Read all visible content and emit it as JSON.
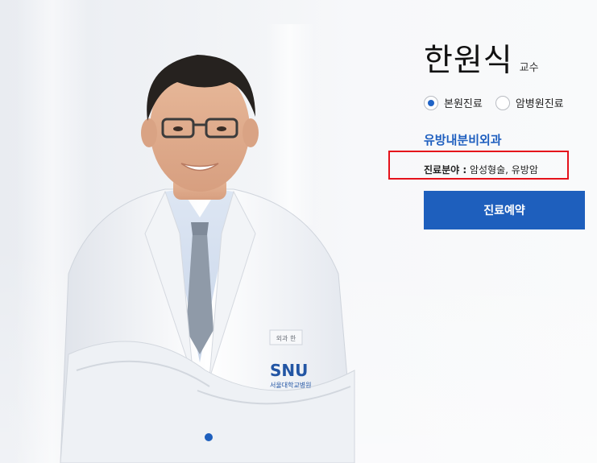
{
  "doctor": {
    "name": "한원식",
    "title": "교수",
    "department": "유방내분비외과",
    "field_label": "진료분야 :",
    "field_value": "암성형술, 유방암",
    "badge_text": "SNU",
    "badge_sub": "서울대학교병원",
    "nametag": "외과 한"
  },
  "location_options": [
    {
      "label": "본원진료",
      "selected": true
    },
    {
      "label": "암병원진료",
      "selected": false
    }
  ],
  "book_button_label": "진료예약",
  "colors": {
    "brand_blue": "#1e5fbd",
    "highlight_red": "#e5121b",
    "department_blue": "#1f5fbf"
  },
  "carousel": {
    "current_slide": 1
  }
}
